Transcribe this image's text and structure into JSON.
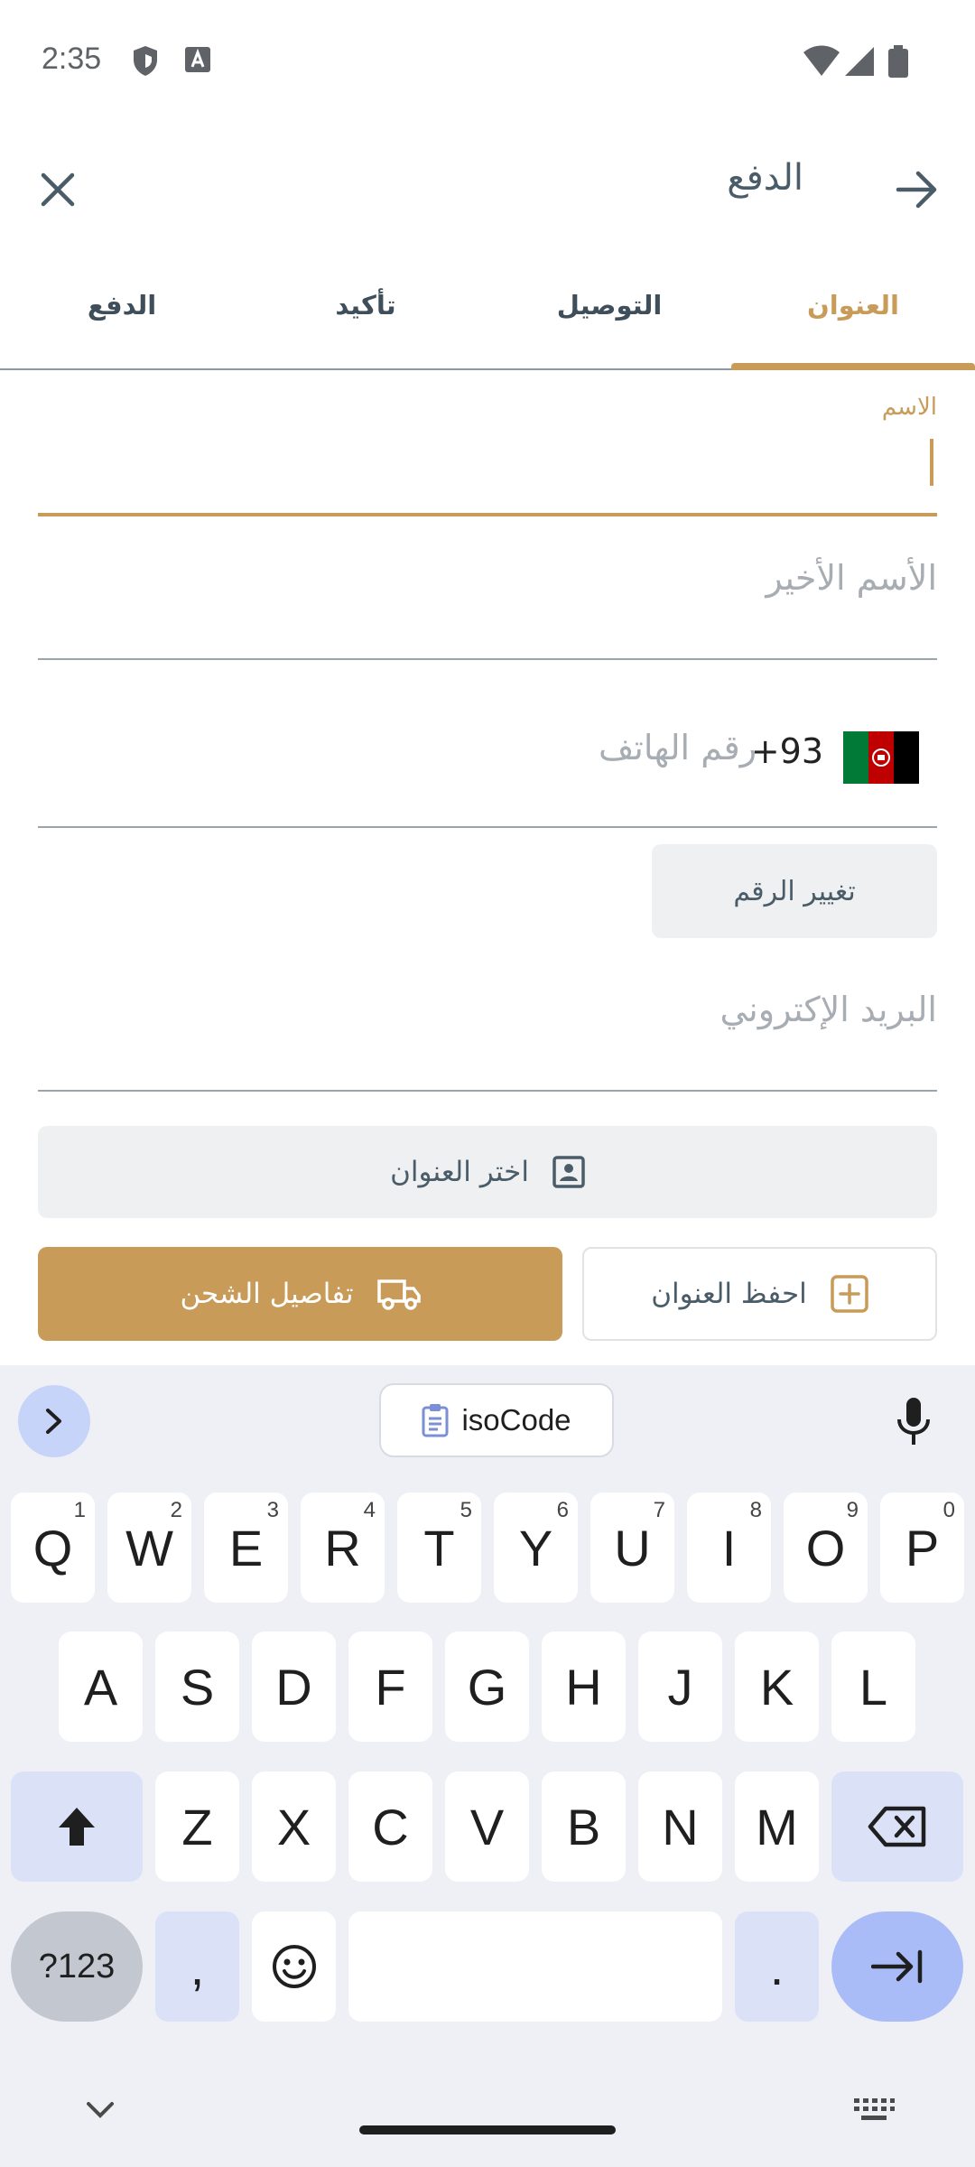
{
  "status_bar": {
    "time": "2:35"
  },
  "app_bar": {
    "title": "الدفع"
  },
  "tabs": [
    {
      "label": "العنوان",
      "active": true
    },
    {
      "label": "التوصيل",
      "active": false
    },
    {
      "label": "تأكيد",
      "active": false
    },
    {
      "label": "الدفع",
      "active": false
    }
  ],
  "form": {
    "first_name_label": "الاسم",
    "first_name_value": "",
    "last_name_placeholder": "الأسم الأخير",
    "dial_code": "+93",
    "phone_placeholder": "رقم الهاتف",
    "change_number_label": "تغيير الرقم",
    "email_placeholder": "البريد الإكتروني"
  },
  "actions": {
    "select_address_label": "اختر العنوان",
    "save_address_label": "احفظ العنوان",
    "shipping_details_label": "تفاصيل الشحن"
  },
  "keyboard": {
    "suggestion": "isoCode",
    "row1": [
      {
        "key": "Q",
        "hint": "1"
      },
      {
        "key": "W",
        "hint": "2"
      },
      {
        "key": "E",
        "hint": "3"
      },
      {
        "key": "R",
        "hint": "4"
      },
      {
        "key": "T",
        "hint": "5"
      },
      {
        "key": "Y",
        "hint": "6"
      },
      {
        "key": "U",
        "hint": "7"
      },
      {
        "key": "I",
        "hint": "8"
      },
      {
        "key": "O",
        "hint": "9"
      },
      {
        "key": "P",
        "hint": "0"
      }
    ],
    "row2": [
      "A",
      "S",
      "D",
      "F",
      "G",
      "H",
      "J",
      "K",
      "L"
    ],
    "row3": [
      "Z",
      "X",
      "C",
      "V",
      "B",
      "N",
      "M"
    ],
    "symbols_label": "?123",
    "comma": ",",
    "period": "."
  },
  "colors": {
    "accent": "#c89b59",
    "text": "#3c4b57",
    "keyboard_bg": "#eff0f5"
  },
  "icons": {
    "close": "close-icon",
    "forward": "arrow-forward-icon",
    "flag": "afghanistan-flag-icon",
    "contact": "contact-card-icon",
    "add": "add-box-icon",
    "truck": "truck-icon"
  }
}
